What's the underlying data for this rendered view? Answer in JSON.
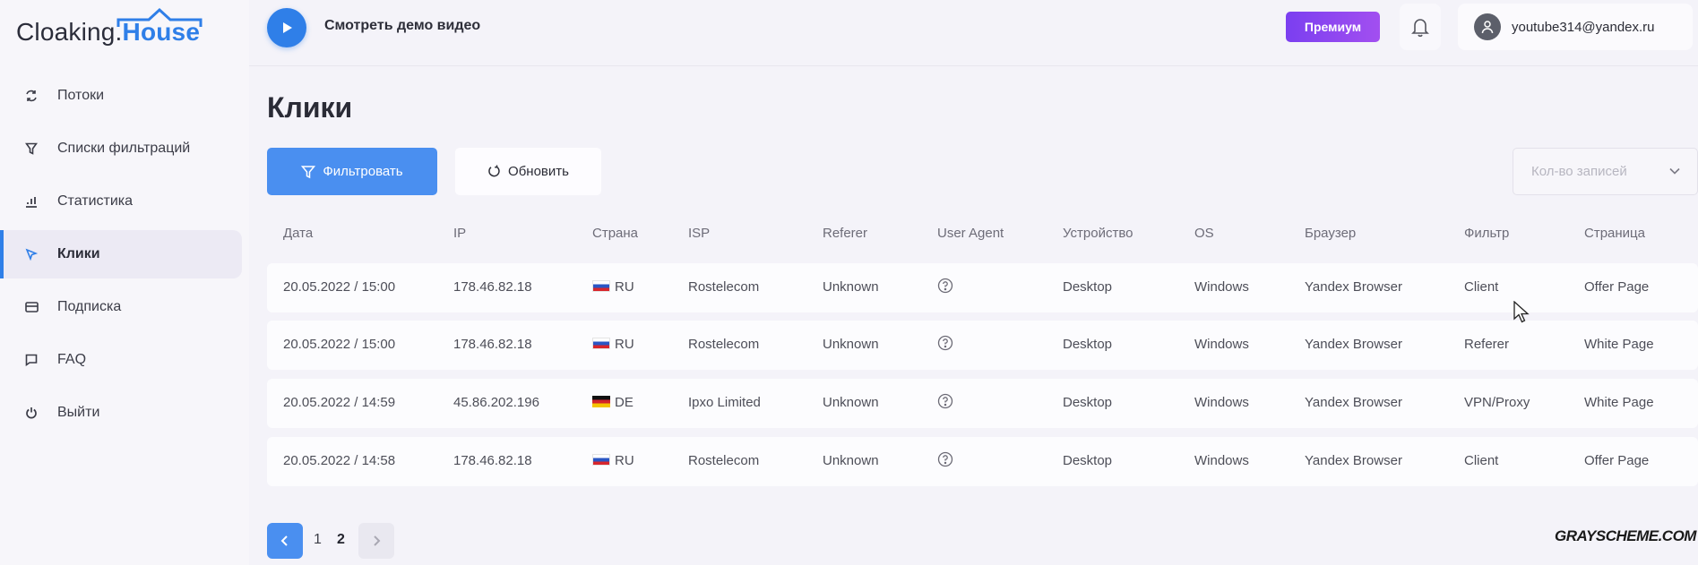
{
  "brand": {
    "logo_part1": "Cloaking.",
    "logo_part2": "House"
  },
  "sidebar": {
    "items": [
      {
        "label": "Потоки",
        "icon": "refresh-icon"
      },
      {
        "label": "Списки фильтраций",
        "icon": "filter-icon"
      },
      {
        "label": "Статистика",
        "icon": "bar-chart-icon"
      },
      {
        "label": "Клики",
        "icon": "pointer-icon",
        "active": true
      },
      {
        "label": "Подписка",
        "icon": "card-icon"
      },
      {
        "label": "FAQ",
        "icon": "chat-icon"
      },
      {
        "label": "Выйти",
        "icon": "power-icon"
      }
    ]
  },
  "topbar": {
    "demo_label": "Смотреть демо видео",
    "premium_label": "Премиум",
    "user_email": "youtube314@yandex.ru"
  },
  "main": {
    "title": "Клики",
    "filter_label": "Фильтровать",
    "refresh_label": "Обновить",
    "count_placeholder": "Кол-во записей"
  },
  "table": {
    "headers": [
      "Дата",
      "IP",
      "Страна",
      "ISP",
      "Referer",
      "User Agent",
      "Устройство",
      "OS",
      "Браузер",
      "Фильтр",
      "Страница"
    ],
    "rows": [
      {
        "date": "20.05.2022 / 15:00",
        "ip": "178.46.82.18",
        "country": "RU",
        "isp": "Rostelecom",
        "referer": "Unknown",
        "device": "Desktop",
        "os": "Windows",
        "browser": "Yandex Browser",
        "filter": "Client",
        "page": "Offer Page"
      },
      {
        "date": "20.05.2022 / 15:00",
        "ip": "178.46.82.18",
        "country": "RU",
        "isp": "Rostelecom",
        "referer": "Unknown",
        "device": "Desktop",
        "os": "Windows",
        "browser": "Yandex Browser",
        "filter": "Referer",
        "page": "White Page"
      },
      {
        "date": "20.05.2022 / 14:59",
        "ip": "45.86.202.196",
        "country": "DE",
        "isp": "Ipxo Limited",
        "referer": "Unknown",
        "device": "Desktop",
        "os": "Windows",
        "browser": "Yandex Browser",
        "filter": "VPN/Proxy",
        "page": "White Page"
      },
      {
        "date": "20.05.2022 / 14:58",
        "ip": "178.46.82.18",
        "country": "RU",
        "isp": "Rostelecom",
        "referer": "Unknown",
        "device": "Desktop",
        "os": "Windows",
        "browser": "Yandex Browser",
        "filter": "Client",
        "page": "Offer Page"
      }
    ]
  },
  "pagination": {
    "pages": [
      "1",
      "2"
    ],
    "current": "2"
  },
  "watermark": "GRAYSCHEME.COM",
  "colors": {
    "accent": "#2f7fe8",
    "premium": "#8b45f0"
  }
}
